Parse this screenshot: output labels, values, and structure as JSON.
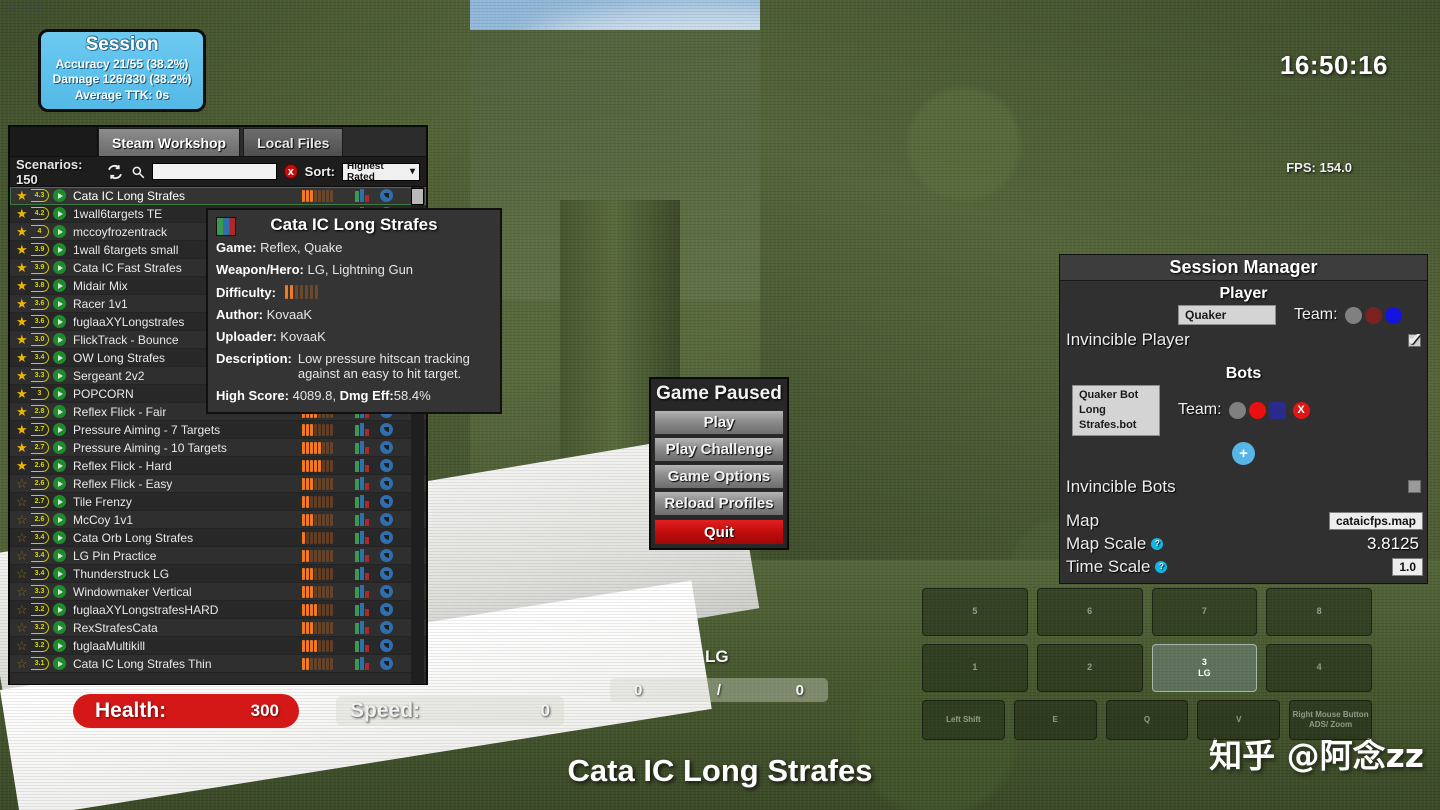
{
  "hud": {
    "fps_ghost": "60 FPS",
    "clock": "16:50:16",
    "fps": "FPS: 154.0",
    "health_label": "Health:",
    "health_value": "300",
    "speed_label": "Speed:",
    "speed_value": "0",
    "ammo_weapon": "LG",
    "ammo_current": "0",
    "ammo_sep": "/",
    "ammo_max": "0",
    "scenario_title": "Cata IC Long Strafes",
    "watermark": "知乎 @阿念zz"
  },
  "session": {
    "title": "Session",
    "accuracy": "Accuracy 21/55 (38.2%)",
    "damage": "Damage 126/330 (38.2%)",
    "ttk": "Average TTK: 0s"
  },
  "browser": {
    "tabs": [
      {
        "label": "Steam Workshop",
        "active": true
      },
      {
        "label": "Local Files",
        "active": false
      }
    ],
    "scenarios_count": "Scenarios: 150",
    "search_value": "",
    "search_placeholder": "",
    "clear_label": "x",
    "sort_label": "Sort:",
    "sort_value": "Highest Rated",
    "rows": [
      {
        "name": "Cata IC Long Strafes",
        "rating": "4.3",
        "starred": true,
        "difficulty": 3,
        "selected": true
      },
      {
        "name": "1wall6targets TE",
        "rating": "4.2",
        "starred": true,
        "difficulty": 5,
        "selected": false
      },
      {
        "name": "mccoyfrozentrack",
        "rating": "4",
        "starred": true,
        "difficulty": 5,
        "selected": false
      },
      {
        "name": "1wall 6targets small",
        "rating": "3.9",
        "starred": true,
        "difficulty": 4,
        "selected": false
      },
      {
        "name": "Cata IC Fast Strafes",
        "rating": "3.9",
        "starred": true,
        "difficulty": 2,
        "selected": false
      },
      {
        "name": "Midair Mix",
        "rating": "3.8",
        "starred": true,
        "difficulty": 3,
        "selected": false
      },
      {
        "name": "Racer 1v1",
        "rating": "3.6",
        "starred": true,
        "difficulty": 1,
        "selected": false
      },
      {
        "name": "fuglaaXYLongstrafes",
        "rating": "3.6",
        "starred": true,
        "difficulty": 2,
        "selected": false
      },
      {
        "name": "FlickTrack - Bounce",
        "rating": "3.0",
        "starred": true,
        "difficulty": 3,
        "selected": false
      },
      {
        "name": "OW Long Strafes",
        "rating": "3.4",
        "starred": true,
        "difficulty": 3,
        "selected": false
      },
      {
        "name": "Sergeant 2v2",
        "rating": "3.3",
        "starred": true,
        "difficulty": 4,
        "selected": false
      },
      {
        "name": "POPCORN",
        "rating": "3",
        "starred": true,
        "difficulty": 3,
        "selected": false
      },
      {
        "name": "Reflex Flick - Fair",
        "rating": "2.8",
        "starred": true,
        "difficulty": 4,
        "selected": false
      },
      {
        "name": "Pressure Aiming - 7 Targets",
        "rating": "2.7",
        "starred": true,
        "difficulty": 3,
        "selected": false
      },
      {
        "name": "Pressure Aiming - 10 Targets",
        "rating": "2.7",
        "starred": true,
        "difficulty": 5,
        "selected": false
      },
      {
        "name": "Reflex Flick - Hard",
        "rating": "2.6",
        "starred": true,
        "difficulty": 5,
        "selected": false
      },
      {
        "name": "Reflex Flick - Easy",
        "rating": "2.6",
        "starred": false,
        "difficulty": 3,
        "selected": false
      },
      {
        "name": "Tile Frenzy",
        "rating": "2.7",
        "starred": false,
        "difficulty": 2,
        "selected": false
      },
      {
        "name": "McCoy 1v1",
        "rating": "2.6",
        "starred": false,
        "difficulty": 3,
        "selected": false
      },
      {
        "name": "Cata Orb Long Strafes",
        "rating": "3.4",
        "starred": false,
        "difficulty": 1,
        "selected": false
      },
      {
        "name": "LG Pin Practice",
        "rating": "3.4",
        "starred": false,
        "difficulty": 2,
        "selected": false
      },
      {
        "name": "Thunderstruck LG",
        "rating": "3.4",
        "starred": false,
        "difficulty": 3,
        "selected": false
      },
      {
        "name": "Windowmaker Vertical",
        "rating": "3.3",
        "starred": false,
        "difficulty": 3,
        "selected": false
      },
      {
        "name": "fuglaaXYLongstrafesHARD",
        "rating": "3.2",
        "starred": false,
        "difficulty": 4,
        "selected": false
      },
      {
        "name": "RexStrafesCata",
        "rating": "3.2",
        "starred": false,
        "difficulty": 3,
        "selected": false
      },
      {
        "name": "fuglaaMultikill",
        "rating": "3.2",
        "starred": false,
        "difficulty": 4,
        "selected": false
      },
      {
        "name": "Cata IC Long Strafes Thin",
        "rating": "3.1",
        "starred": false,
        "difficulty": 2,
        "selected": false
      }
    ]
  },
  "tooltip": {
    "title": "Cata IC Long Strafes",
    "game_key": "Game:",
    "game_value": "Reflex, Quake",
    "weapon_key": "Weapon/Hero:",
    "weapon_value": "LG, Lightning Gun",
    "difficulty_key": "Difficulty:",
    "difficulty_level": 2,
    "difficulty_max": 7,
    "author_key": "Author:",
    "author_value": "KovaaK",
    "uploader_key": "Uploader:",
    "uploader_value": "KovaaK",
    "description_key": "Description:",
    "description_value": "Low pressure hitscan tracking against an easy to hit target.",
    "highscore_key": "High Score:",
    "highscore_value": "4089.8,",
    "dmgeff_key": "Dmg Eff:",
    "dmgeff_value": "58.4%"
  },
  "paused_menu": {
    "title": "Game Paused",
    "buttons": [
      {
        "label": "Play",
        "kind": "normal"
      },
      {
        "label": "Play Challenge",
        "kind": "normal"
      },
      {
        "label": "Game Options",
        "kind": "normal"
      },
      {
        "label": "Reload Profiles",
        "kind": "normal"
      },
      {
        "label": "Quit",
        "kind": "quit"
      }
    ]
  },
  "session_manager": {
    "title": "Session Manager",
    "player_section": "Player",
    "player_name": "Quaker",
    "player_team_label": "Team:",
    "invincible_player_label": "Invincible Player",
    "invincible_player_checked": true,
    "bots_section": "Bots",
    "bot_name": "Quaker Bot Long Strafes.bot",
    "bot_team_label": "Team:",
    "bot_remove_label": "X",
    "add_bot_label": "+",
    "invincible_bots_label": "Invincible Bots",
    "invincible_bots_checked": false,
    "map_label": "Map",
    "map_value": "cataicfps.map",
    "map_scale_label": "Map Scale",
    "map_scale_value": "3.8125",
    "time_scale_label": "Time Scale",
    "time_scale_value": "1.0",
    "help_icon": "?"
  },
  "slots": {
    "row_top": [
      "5",
      "6",
      "7",
      "8"
    ],
    "row_mid": [
      {
        "key": "1",
        "name": "",
        "active": false
      },
      {
        "key": "2",
        "name": "",
        "active": false
      },
      {
        "key": "3",
        "name": "LG",
        "active": true
      },
      {
        "key": "4",
        "name": "",
        "active": false
      }
    ],
    "row_bottom": [
      "Left Shift",
      "E",
      "Q",
      "V",
      "Right Mouse Button ADS/ Zoom"
    ]
  },
  "colors": {
    "accent_blue": "#5ec2ec",
    "danger_red": "#d41818",
    "star_gold": "#f0b400",
    "difficulty_orange": "#ef7a21",
    "team_blue": "#1414e0",
    "team_red": "#e01515",
    "team_grey": "#808080"
  }
}
